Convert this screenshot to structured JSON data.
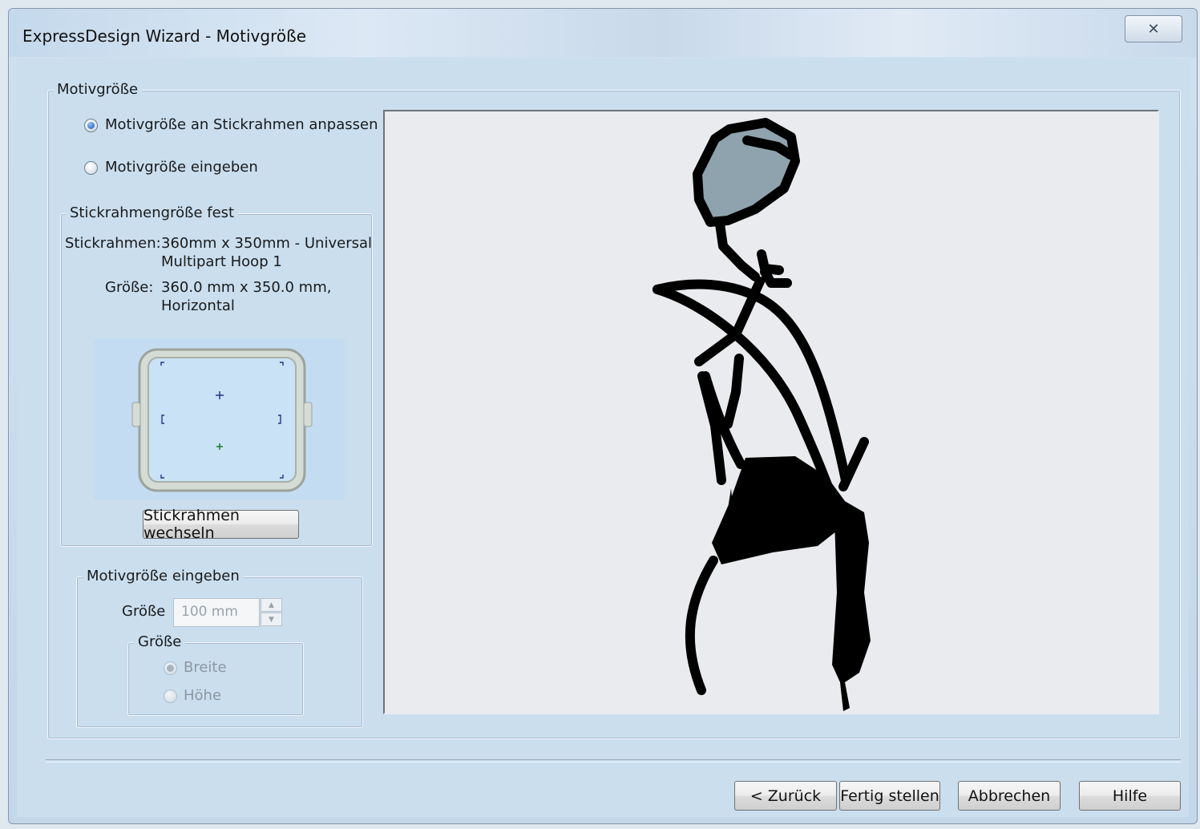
{
  "window": {
    "title": "ExpressDesign Wizard - Motivgröße",
    "close_icon": "close-icon"
  },
  "motif_group": {
    "label": "Motivgröße",
    "radio_fit": "Motivgröße an Stickrahmen anpassen",
    "radio_enter": "Motivgröße eingeben",
    "selected": "radio_fit"
  },
  "hoop_group": {
    "label": "Stickrahmengröße fest",
    "hoop_label": "Stickrahmen:",
    "hoop_value_line1": "360mm x 350mm - Universal",
    "hoop_value_line2": "Multipart Hoop 1",
    "size_label": "Größe:",
    "size_value_line1": "360.0 mm x 350.0 mm,",
    "size_value_line2": "Horizontal",
    "change_button": "Stickrahmen wechseln"
  },
  "enter_group": {
    "label": "Motivgröße eingeben",
    "size_label": "Größe",
    "size_value": "100 mm",
    "sub_group_label": "Größe",
    "radio_width": "Breite",
    "radio_height": "Höhe"
  },
  "footer": {
    "back_button": "< Zurück",
    "finish_button": "Fertig stellen",
    "cancel_button": "Abbrechen",
    "help_button": "Hilfe"
  },
  "colors": {
    "window_bg": "#cadeee",
    "preview_bg": "#e9ebee",
    "embroidery_black": "#000000",
    "embroidery_fill": "#8ea3ad"
  }
}
